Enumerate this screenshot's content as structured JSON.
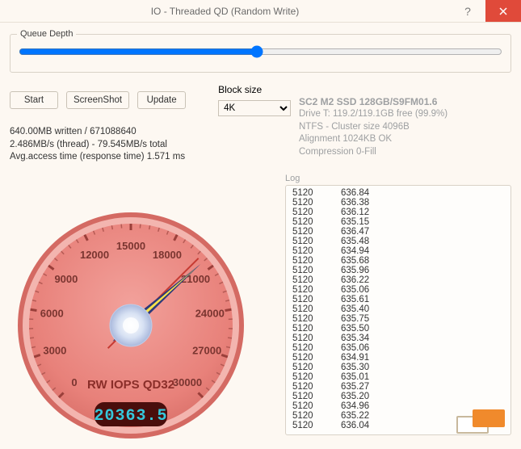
{
  "window": {
    "title": "IO - Threaded QD (Random Write)"
  },
  "queue_depth": {
    "label": "Queue Depth",
    "value": 32
  },
  "buttons": {
    "start": "Start",
    "screenshot": "ScreenShot",
    "update": "Update"
  },
  "block_size": {
    "label": "Block size",
    "value": "4K"
  },
  "drive": {
    "name": "SC2 M2 SSD 128GB/S9FM01.6",
    "info": "Drive T: 119.2/119.1GB free (99.9%)",
    "fs": "NTFS - Cluster size 4096B",
    "align": "Alignment 1024KB OK",
    "comp": "Compression 0-Fill"
  },
  "stats": {
    "line1": "640.00MB written / 671088640",
    "line2": "2.486MB/s (thread) - 79.545MB/s total",
    "line3": "Avg.access time (response time) 1.571 ms"
  },
  "gauge": {
    "ticks": [
      "0",
      "3000",
      "6000",
      "9000",
      "12000",
      "15000",
      "18000",
      "21000",
      "24000",
      "27000",
      "30000"
    ],
    "label": "RW IOPS QD32",
    "reading": "20363.5",
    "value_ratio": 0.68
  },
  "log": {
    "label": "Log",
    "rows": [
      [
        "5120",
        "636.84"
      ],
      [
        "5120",
        "636.38"
      ],
      [
        "5120",
        "636.12"
      ],
      [
        "5120",
        "635.15"
      ],
      [
        "5120",
        "636.47"
      ],
      [
        "5120",
        "635.48"
      ],
      [
        "5120",
        "634.94"
      ],
      [
        "5120",
        "635.68"
      ],
      [
        "5120",
        "635.96"
      ],
      [
        "5120",
        "636.22"
      ],
      [
        "5120",
        "635.06"
      ],
      [
        "5120",
        "635.61"
      ],
      [
        "5120",
        "635.40"
      ],
      [
        "5120",
        "635.75"
      ],
      [
        "5120",
        "635.50"
      ],
      [
        "5120",
        "635.34"
      ],
      [
        "5120",
        "635.06"
      ],
      [
        "5120",
        "634.91"
      ],
      [
        "5120",
        "635.30"
      ],
      [
        "5120",
        "635.01"
      ],
      [
        "5120",
        "635.27"
      ],
      [
        "5120",
        "635.20"
      ],
      [
        "5120",
        "634.96"
      ],
      [
        "5120",
        "635.22"
      ],
      [
        "5120",
        "636.04"
      ]
    ]
  },
  "colors": {
    "gauge_face": "#e8817a",
    "gauge_rim": "#d46a63",
    "gauge_tick": "#9a3f3a",
    "gauge_hub": "#d7e1f3",
    "needle_main": "#2d3a7a",
    "needle_tip": "#f7e24a",
    "digital": "#35c7db"
  }
}
